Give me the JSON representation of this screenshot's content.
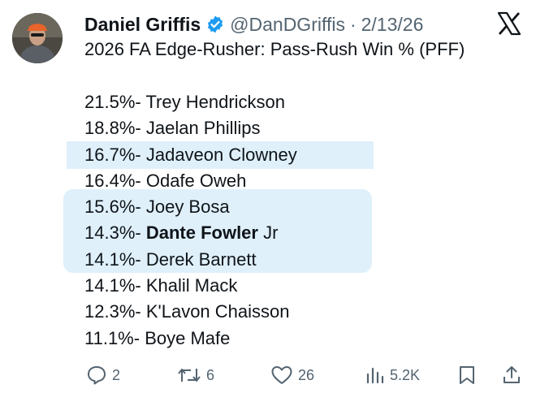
{
  "author": {
    "name": "Daniel Griffis",
    "handle": "@DanDGriffis",
    "separator": "·",
    "date": "2/13/26"
  },
  "post": {
    "headline": "2026 FA Edge-Rusher: Pass-Rush Win % (PFF)",
    "rankings": [
      {
        "pct": "21.5%-",
        "name": "Trey Hendrickson"
      },
      {
        "pct": "18.8%-",
        "name": "Jaelan Phillips"
      },
      {
        "pct": "16.7%-",
        "name": "Jadaveon Clowney",
        "highlight": true
      },
      {
        "pct": "16.4%-",
        "name": "Odafe Oweh"
      },
      {
        "pct": "15.6%-",
        "name": "Joey Bosa",
        "highlight": true
      },
      {
        "pct": "14.3%-",
        "name_bold": "Dante Fowler",
        "name_suffix": "Jr",
        "highlight": true
      },
      {
        "pct": "14.1%-",
        "name": "Derek Barnett",
        "highlight": true
      },
      {
        "pct": "14.1%-",
        "name": "Khalil Mack"
      },
      {
        "pct": "12.3%-",
        "name": "K'Lavon Chaisson"
      },
      {
        "pct": "11.1%-",
        "name": "Boye Mafe"
      }
    ]
  },
  "actions": {
    "replies": "2",
    "reposts": "6",
    "likes": "26",
    "views": "5.2K"
  },
  "icons": [
    "avatar",
    "verified-badge-icon",
    "x-logo-icon",
    "reply-icon",
    "repost-icon",
    "like-icon",
    "views-icon",
    "bookmark-icon",
    "share-icon"
  ],
  "colors": {
    "accent": "#1d9bf0",
    "highlight": "#dff0fb",
    "muted": "#536471",
    "text": "#0f1419"
  }
}
